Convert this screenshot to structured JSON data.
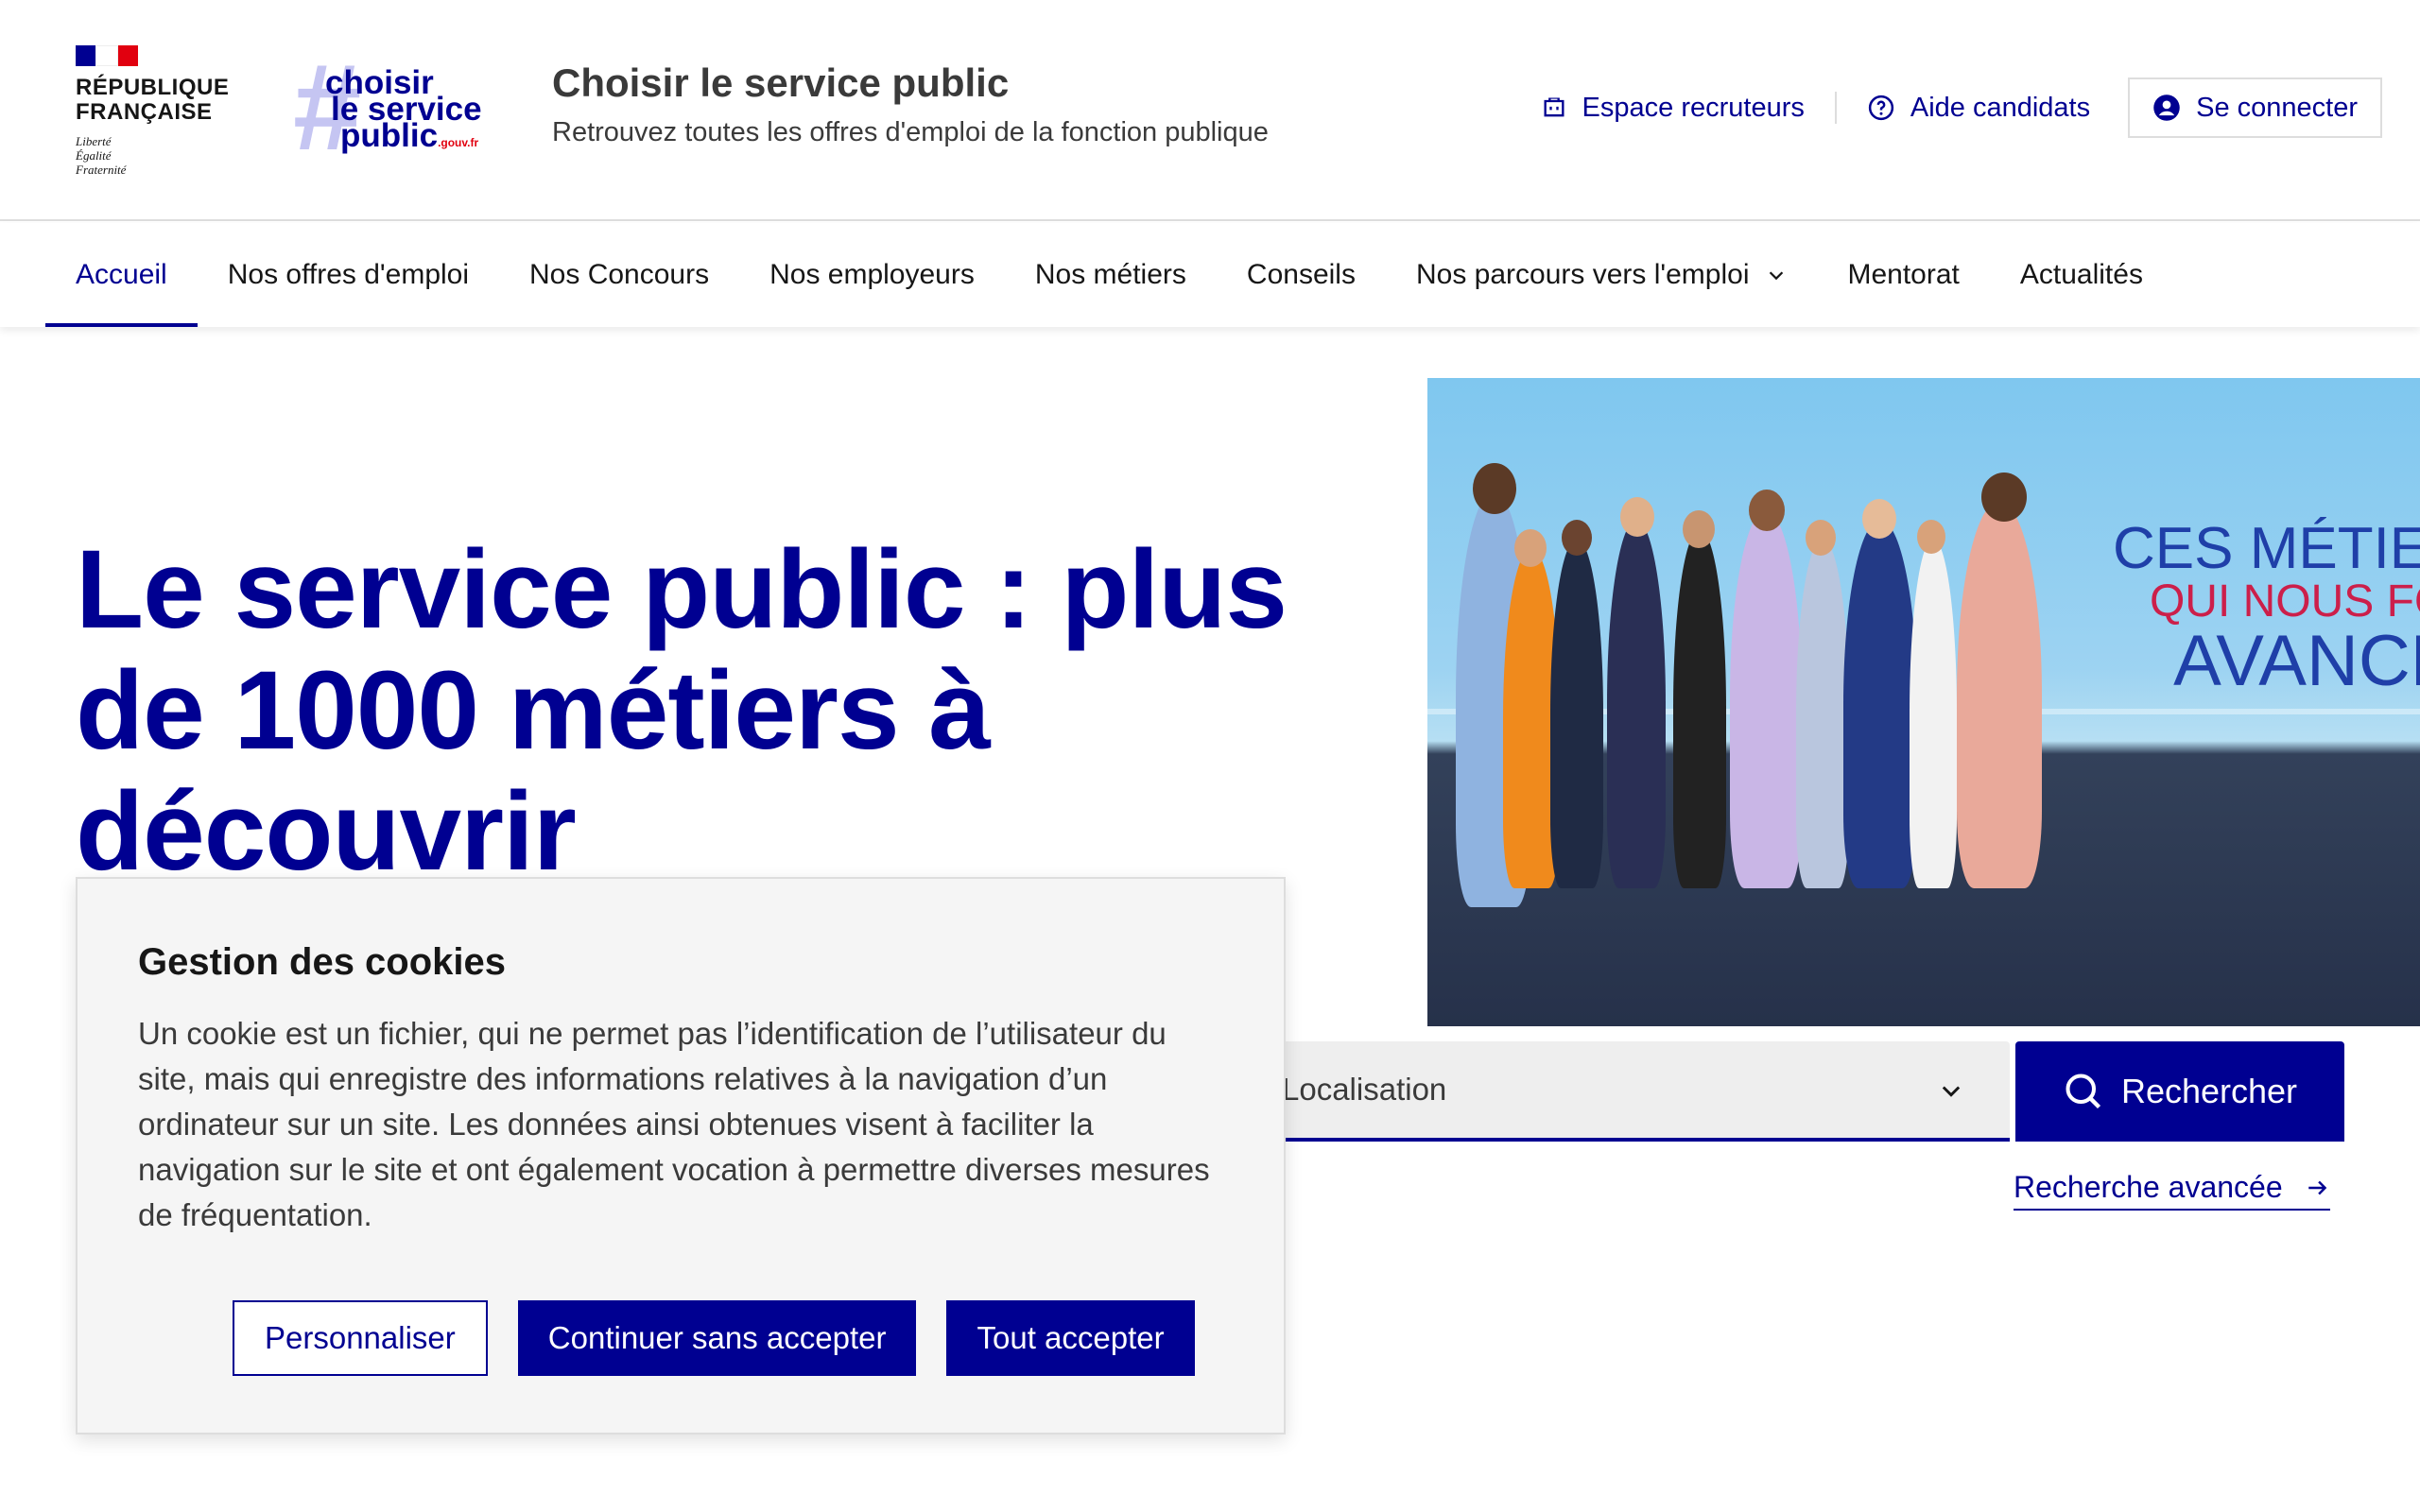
{
  "header": {
    "rf_name_line1": "RÉPUBLIQUE",
    "rf_name_line2": "FRANÇAISE",
    "rf_motto_1": "Liberté",
    "rf_motto_2": "Égalité",
    "rf_motto_3": "Fraternité",
    "csp_logo_1": "choisir",
    "csp_logo_2": "le service",
    "csp_logo_3": "public",
    "csp_logo_domain": ".gouv.fr",
    "site_title": "Choisir le service public",
    "site_tagline": "Retrouvez toutes les offres d'emploi de la fonction publique",
    "tools": {
      "recruiters": "Espace recruteurs",
      "help": "Aide candidats",
      "login": "Se connecter"
    }
  },
  "nav": {
    "items": [
      {
        "label": "Accueil"
      },
      {
        "label": "Nos offres d'emploi"
      },
      {
        "label": "Nos Concours"
      },
      {
        "label": "Nos employeurs"
      },
      {
        "label": "Nos métiers"
      },
      {
        "label": "Conseils"
      },
      {
        "label": "Nos parcours vers l'emploi"
      },
      {
        "label": "Mentorat"
      },
      {
        "label": "Actualités"
      }
    ],
    "active_index": 0
  },
  "hero": {
    "title": "Le service public : plus de 1000 métiers à découvrir",
    "image_text_1": "CES MÉTIERS",
    "image_text_2": "QUI NOUS FONT",
    "image_text_3": "AVANCER"
  },
  "search": {
    "location_placeholder": "Localisation",
    "search_button": "Rechercher",
    "advanced_link": "Recherche avancée"
  },
  "cookie": {
    "title": "Gestion des cookies",
    "text": "Un cookie est un fichier, qui ne permet pas l’identification de l’utilisateur du site, mais qui enregistre des informations relatives à la navigation d’un ordinateur sur un site. Les données ainsi obtenues visent à faciliter la navigation sur le site et ont également vocation à permettre diverses mesures de fréquentation.",
    "btn_customize": "Personnaliser",
    "btn_continue": "Continuer sans accepter",
    "btn_accept": "Tout accepter"
  },
  "colors": {
    "brand_blue": "#000091",
    "flag_blue": "#000091",
    "flag_white": "#ffffff",
    "flag_red": "#e1000f"
  }
}
